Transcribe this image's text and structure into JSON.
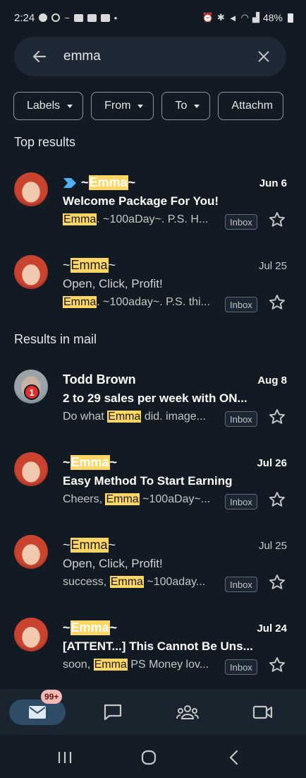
{
  "status_bar": {
    "time": "2:24",
    "battery": "48%"
  },
  "search": {
    "query": "emma"
  },
  "filters": [
    {
      "label": "Labels"
    },
    {
      "label": "From"
    },
    {
      "label": "To"
    },
    {
      "label": "Attachm"
    }
  ],
  "sections": {
    "top_results": "Top results",
    "results_in_mail": "Results in mail"
  },
  "top_results": [
    {
      "sender_pre": "~",
      "sender_hl": "Emma",
      "sender_post": "~",
      "date": "Jun 6",
      "subject": "Welcome Package For You!",
      "snippet_pre": "",
      "snippet_hl": "Emma",
      "snippet_post": ". ~100aDay~. P.S. H...",
      "label": "Inbox"
    },
    {
      "sender_pre": "~",
      "sender_hl": "Emma",
      "sender_post": "~",
      "date": "Jul 25",
      "subject": "Open, Click, Profit!",
      "snippet_pre": "",
      "snippet_hl": "Emma",
      "snippet_post": ". ~100aday~. P.S. thi...",
      "label": "Inbox"
    }
  ],
  "mail_results": [
    {
      "sender": "Todd Brown",
      "avatar_badge": "1",
      "date": "Aug 8",
      "subject": "2 to 29 sales per week with ON...",
      "snippet_pre": "Do what ",
      "snippet_hl": "Emma",
      "snippet_post": " did. image...",
      "label": "Inbox"
    },
    {
      "sender_pre": "~",
      "sender_hl": "Emma",
      "sender_post": "~",
      "date": "Jul 26",
      "subject": "Easy Method To Start Earning",
      "snippet_pre": "Cheers, ",
      "snippet_hl": "Emma",
      "snippet_post": " ~100aDay~...",
      "label": "Inbox"
    },
    {
      "sender_pre": "~",
      "sender_hl": "Emma",
      "sender_post": "~",
      "date": "Jul 25",
      "subject": "Open, Click, Profit!",
      "snippet_pre": "success, ",
      "snippet_hl": "Emma",
      "snippet_post": " ~100aday...",
      "label": "Inbox"
    },
    {
      "sender_pre": "~",
      "sender_hl": "Emma",
      "sender_post": "~",
      "date": "Jul 24",
      "subject": "[ATTENT...] This Cannot Be Uns...",
      "snippet_pre": "soon, ",
      "snippet_hl": "Emma",
      "snippet_post": " PS Money lov...",
      "label": "Inbox"
    }
  ],
  "bottom_nav": {
    "mail_badge": "99+"
  },
  "colors": {
    "background": "#121a23",
    "highlight": "#fdd663",
    "accent_pill": "#2e4c66",
    "important_marker": "#4fb0f5",
    "badge_red": "#e0312b"
  }
}
